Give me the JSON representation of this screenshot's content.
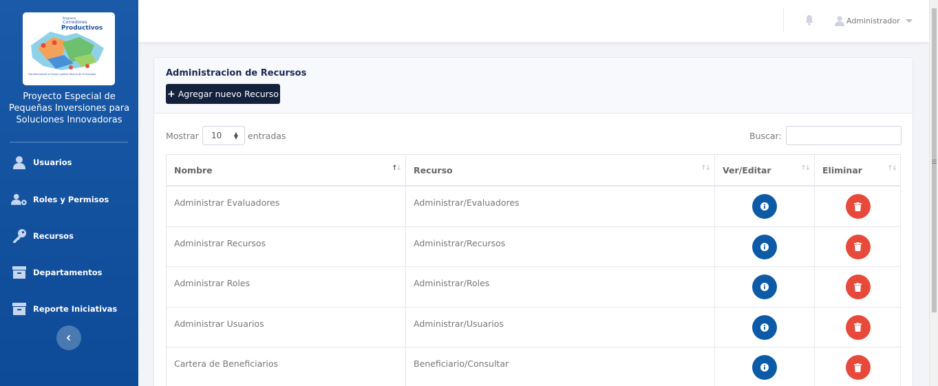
{
  "sidebar": {
    "logo": {
      "line1": "Programa",
      "line2": "Corredores",
      "line3": "Productivos",
      "tagline": "Transformando la Franja Costero-Marina de El Salvador"
    },
    "brand_line1": "Proyecto Especial de",
    "brand_line2": "Pequeñas Inversiones para",
    "brand_line3": "Soluciones Innovadoras",
    "items": [
      {
        "label": "Usuarios",
        "icon": "user-icon"
      },
      {
        "label": "Roles y Permisos",
        "icon": "users-cog-icon"
      },
      {
        "label": "Recursos",
        "icon": "key-icon"
      },
      {
        "label": "Departamentos",
        "icon": "archive-icon"
      },
      {
        "label": "Reporte Iniciativas",
        "icon": "archive-icon"
      }
    ],
    "collapse_icon": "chevron-left-icon"
  },
  "topbar": {
    "bell_icon": "bell-icon",
    "user_icon": "user-icon",
    "user_name": "Administrador"
  },
  "card": {
    "title": "Administracion de Recursos",
    "add_button": "Agregar nuevo Recurso"
  },
  "table_controls": {
    "show_label": "Mostrar",
    "page_length": "10",
    "entries_label": "entradas",
    "search_label": "Buscar:",
    "search_value": ""
  },
  "table": {
    "columns": [
      "Nombre",
      "Recurso",
      "Ver/Editar",
      "Eliminar"
    ],
    "rows": [
      {
        "nombre": "Administrar Evaluadores",
        "recurso": "Administrar/Evaluadores"
      },
      {
        "nombre": "Administrar Recursos",
        "recurso": "Administrar/Recursos"
      },
      {
        "nombre": "Administrar Roles",
        "recurso": "Administrar/Roles"
      },
      {
        "nombre": "Administrar Usuarios",
        "recurso": "Administrar/Usuarios"
      },
      {
        "nombre": "Cartera de Beneficiarios",
        "recurso": "Beneficiario/Consultar"
      }
    ]
  },
  "colors": {
    "sidebar": "#0d4a97",
    "primary_dark": "#14213d",
    "info": "#0d5aa7",
    "danger": "#e74a3b"
  }
}
